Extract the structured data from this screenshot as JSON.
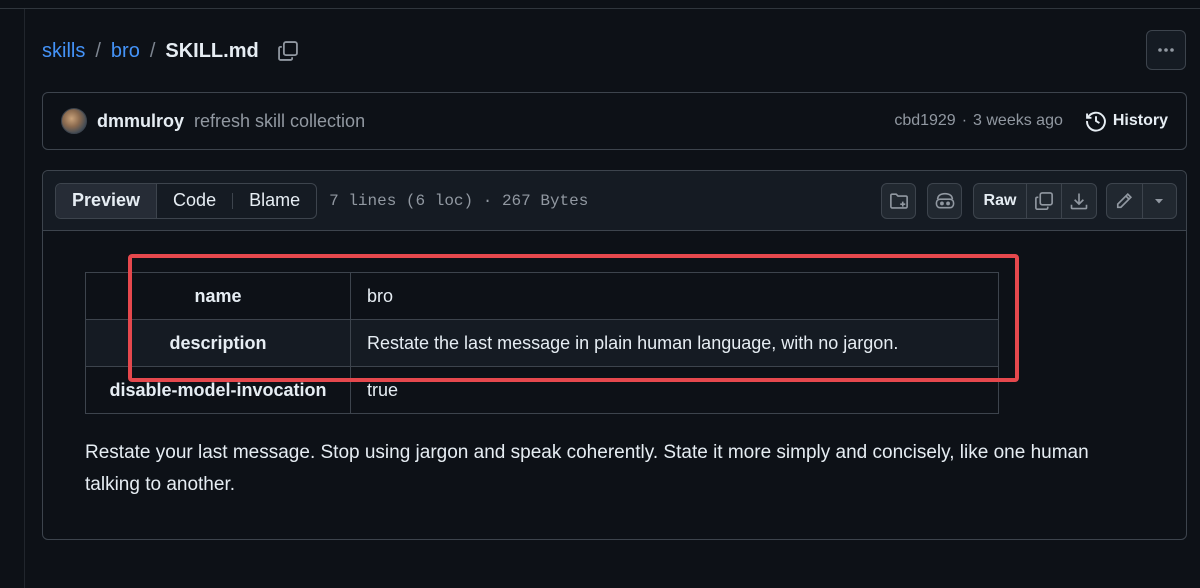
{
  "breadcrumb": {
    "items": [
      "skills",
      "bro"
    ],
    "separator": "/",
    "current": "SKILL.md"
  },
  "commit": {
    "author": "dmmulroy",
    "message": "refresh skill collection",
    "sha": "cbd1929",
    "separator": "·",
    "time": "3 weeks ago",
    "history_label": "History"
  },
  "file": {
    "tabs": [
      "Preview",
      "Code",
      "Blame"
    ],
    "active_tab": "Preview",
    "meta": "7 lines (6 loc) · 267 Bytes",
    "raw_label": "Raw"
  },
  "frontmatter": {
    "rows": [
      {
        "key": "name",
        "value": "bro"
      },
      {
        "key": "description",
        "value": "Restate the last message in plain human language, with no jargon."
      },
      {
        "key": "disable-model-invocation",
        "value": "true"
      }
    ]
  },
  "content": {
    "body": "Restate your last message. Stop using jargon and speak coherently. State it more simply and concisely, like one human talking to another."
  },
  "colors": {
    "background": "#0d1117",
    "link": "#4493f8",
    "highlight": "#e5484d"
  },
  "icons": [
    "copy-icon",
    "kebab-icon",
    "history-icon",
    "folder-add-icon",
    "copilot-icon",
    "download-icon",
    "pencil-icon",
    "triangle-down-icon"
  ]
}
